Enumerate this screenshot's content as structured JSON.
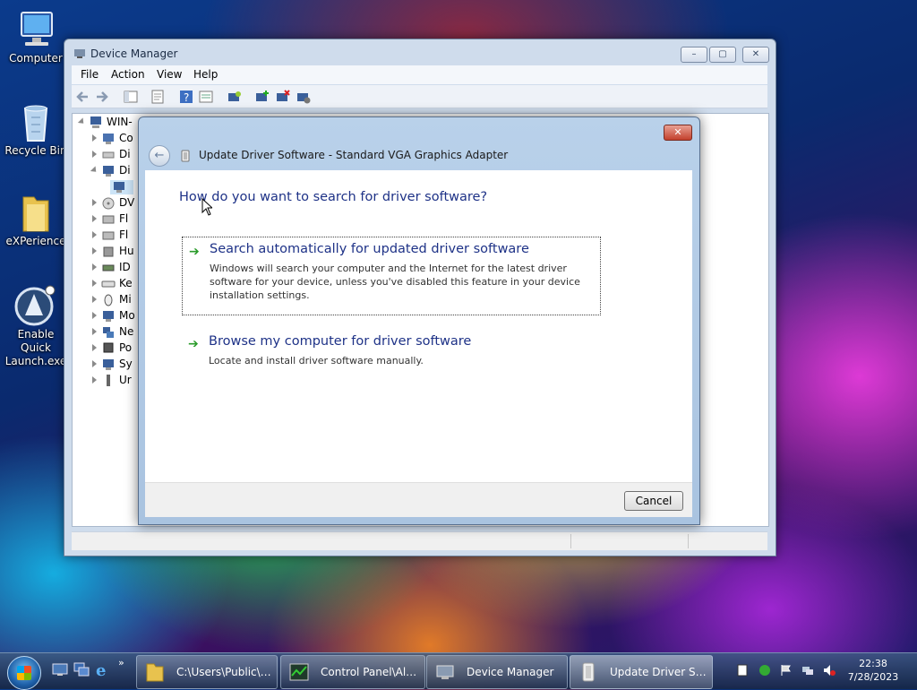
{
  "desktop": {
    "icons": [
      {
        "label": "Computer",
        "icon": "computer-icon"
      },
      {
        "label": "Recycle Bin",
        "icon": "recycle-bin-icon"
      },
      {
        "label": "eXPerience",
        "icon": "folder-icon"
      },
      {
        "label": "Enable Quick Launch.exe",
        "icon": "app-icon"
      }
    ]
  },
  "device_manager": {
    "title": "Device Manager",
    "menu": [
      "File",
      "Action",
      "View",
      "Help"
    ],
    "tree": {
      "root": "WIN-",
      "items": [
        "Co",
        "Di",
        "Di",
        "DV",
        "Fl",
        "Fl",
        "Hu",
        "ID",
        "Ke",
        "Mi",
        "Mo",
        "Ne",
        "Po",
        "Sy",
        "Ur"
      ]
    }
  },
  "dialog": {
    "title": "Update Driver Software - Standard VGA Graphics Adapter",
    "heading": "How do you want to search for driver software?",
    "option1": {
      "title": "Search automatically for updated driver software",
      "description": "Windows will search your computer and the Internet for the latest driver software for your device, unless you've disabled this feature in your device installation settings."
    },
    "option2": {
      "title": "Browse my computer for driver software",
      "description": "Locate and install driver software manually."
    },
    "cancel": "Cancel"
  },
  "taskbar": {
    "tasks": [
      {
        "label": "C:\\Users\\Public\\D...",
        "active": false
      },
      {
        "label": "Control Panel\\All ...",
        "active": false
      },
      {
        "label": "Device Manager",
        "active": false
      },
      {
        "label": "Update Driver Sof...",
        "active": true
      }
    ],
    "time": "22:38",
    "date": "7/28/2023"
  },
  "colors": {
    "link_blue": "#1e3287",
    "arrow_green": "#2a9b2a",
    "close_red": "#c3402c"
  }
}
